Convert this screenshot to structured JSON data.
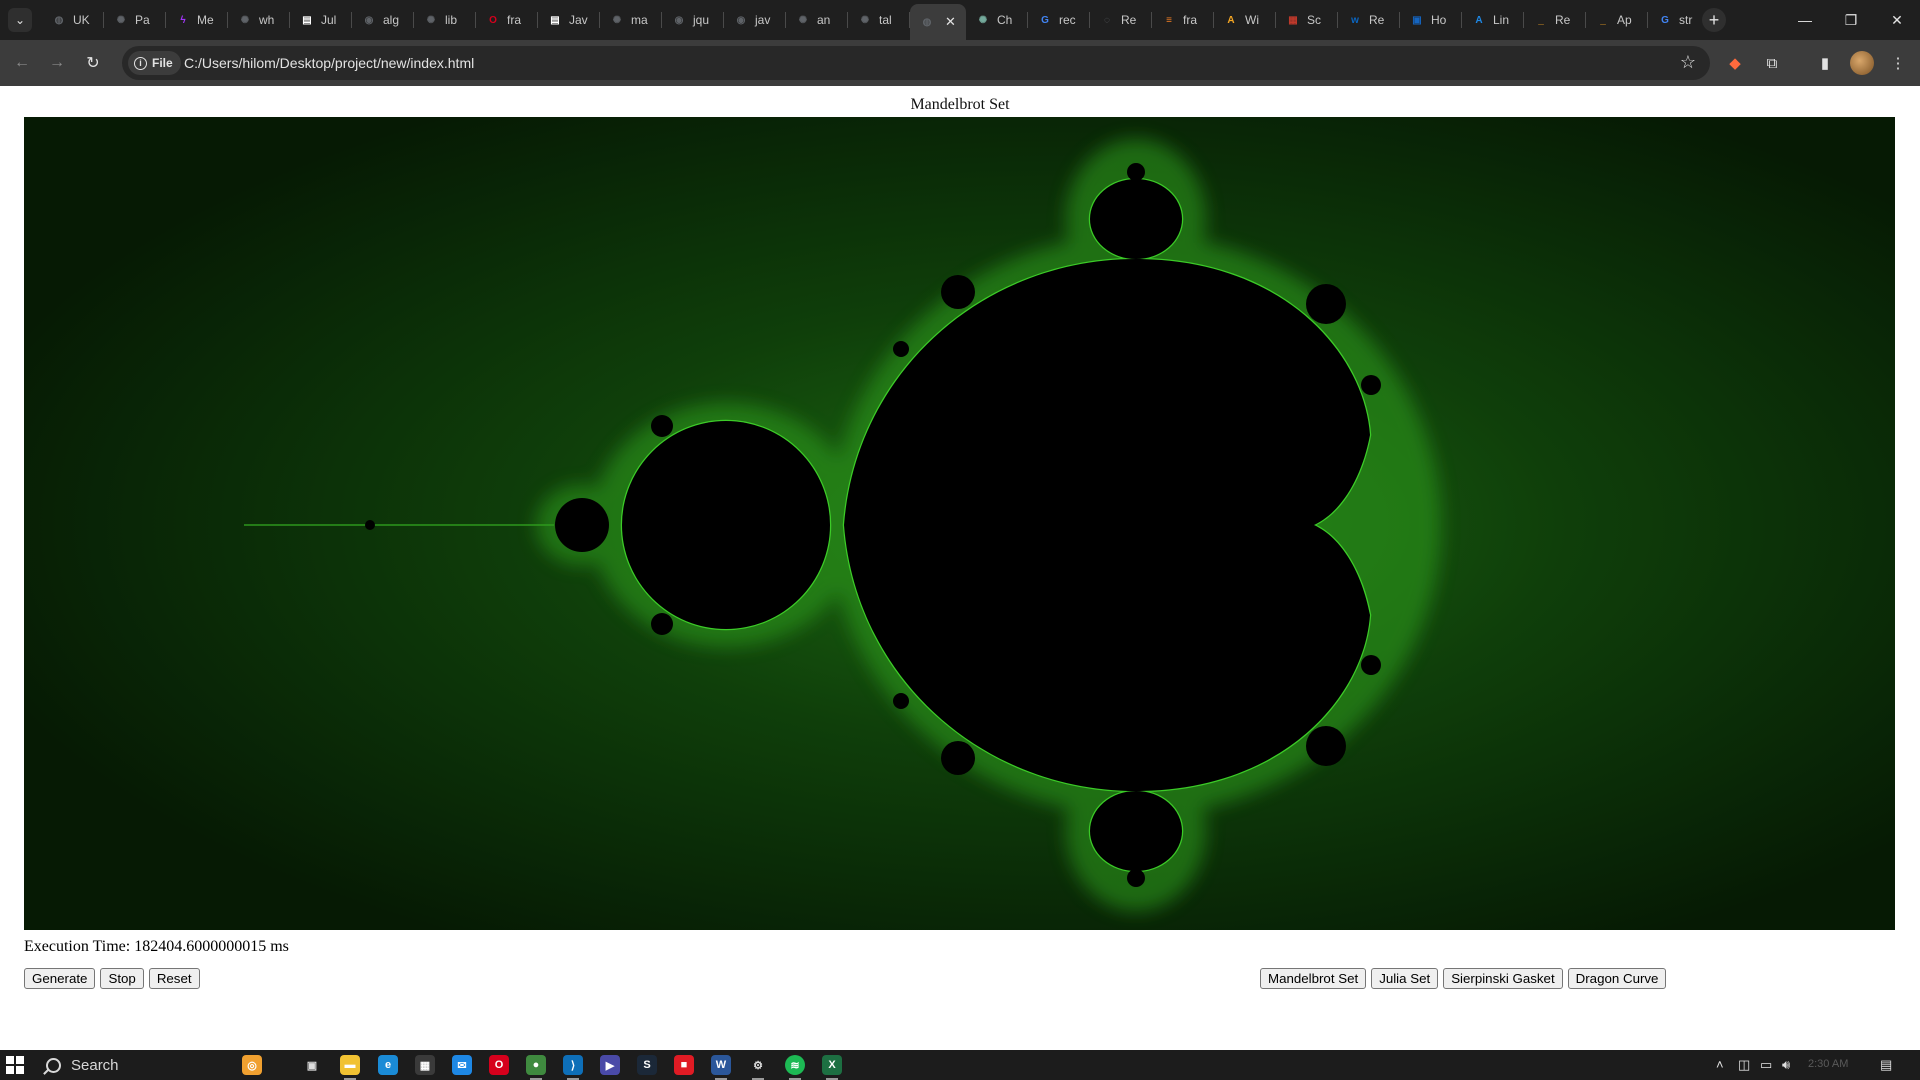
{
  "browser": {
    "tabs": [
      {
        "label": "UK",
        "icon": "globe-icon",
        "color": "#5f6368"
      },
      {
        "label": "Pa",
        "icon": "openai-icon",
        "color": "#5f6368"
      },
      {
        "label": "Me",
        "icon": "messenger-icon",
        "color": "#a334fa"
      },
      {
        "label": "wh",
        "icon": "openai-icon",
        "color": "#5f6368"
      },
      {
        "label": "Jul",
        "icon": "page-icon",
        "color": "#ffffff"
      },
      {
        "label": "alg",
        "icon": "github-icon",
        "color": "#5f6368"
      },
      {
        "label": "lib",
        "icon": "openai-icon",
        "color": "#5f6368"
      },
      {
        "label": "fra",
        "icon": "opera-icon",
        "color": "#d6001c"
      },
      {
        "label": "Jav",
        "icon": "page-icon",
        "color": "#ffffff"
      },
      {
        "label": "ma",
        "icon": "openai-icon",
        "color": "#5f6368"
      },
      {
        "label": "jqu",
        "icon": "github-icon",
        "color": "#5f6368"
      },
      {
        "label": "jav",
        "icon": "github-icon",
        "color": "#5f6368"
      },
      {
        "label": "an",
        "icon": "openai-icon",
        "color": "#5f6368"
      },
      {
        "label": "tal",
        "icon": "openai-icon",
        "color": "#5f6368"
      },
      {
        "label": "",
        "icon": "globe-icon",
        "color": "#5f6368",
        "active": true
      },
      {
        "label": "Ch",
        "icon": "chatgpt-icon",
        "color": "#74aa9c"
      },
      {
        "label": "rec",
        "icon": "google-icon",
        "color": "#4285f4"
      },
      {
        "label": "Re",
        "icon": "loading-icon",
        "color": "#5f6368"
      },
      {
        "label": "fra",
        "icon": "stack-icon",
        "color": "#f48024"
      },
      {
        "label": "Wi",
        "icon": "a-icon",
        "color": "#f5a623"
      },
      {
        "label": "Sc",
        "icon": "grid-icon",
        "color": "#c0392b"
      },
      {
        "label": "Re",
        "icon": "w-icon",
        "color": "#0a66c2"
      },
      {
        "label": "Ho",
        "icon": "box-icon",
        "color": "#1565c0"
      },
      {
        "label": "Lin",
        "icon": "a-icon",
        "color": "#1e88e5"
      },
      {
        "label": "Re",
        "icon": "dash-icon",
        "color": "#f5a623"
      },
      {
        "label": "Ap",
        "icon": "dash-icon",
        "color": "#f5a623"
      },
      {
        "label": "str",
        "icon": "google-icon",
        "color": "#4285f4"
      }
    ],
    "new_tab_label": "+",
    "chip_label": "File",
    "url": "C:/Users/hilom/Desktop/project/new/index.html"
  },
  "page": {
    "title": "Mandelbrot Set",
    "execution_time_text": "Execution Time: 182404.6000000015 ms",
    "fractal_colors": {
      "background": "#0a2a06",
      "edge": "#31c21f",
      "set": "#000000"
    }
  },
  "controls": {
    "generate": "Generate",
    "stop": "Stop",
    "reset": "Reset",
    "mandelbrot": "Mandelbrot Set",
    "julia": "Julia Set",
    "sierpinski": "Sierpinski Gasket",
    "dragon": "Dragon Curve"
  },
  "taskbar": {
    "search_label": "Search",
    "clock": "2:30 AM"
  }
}
